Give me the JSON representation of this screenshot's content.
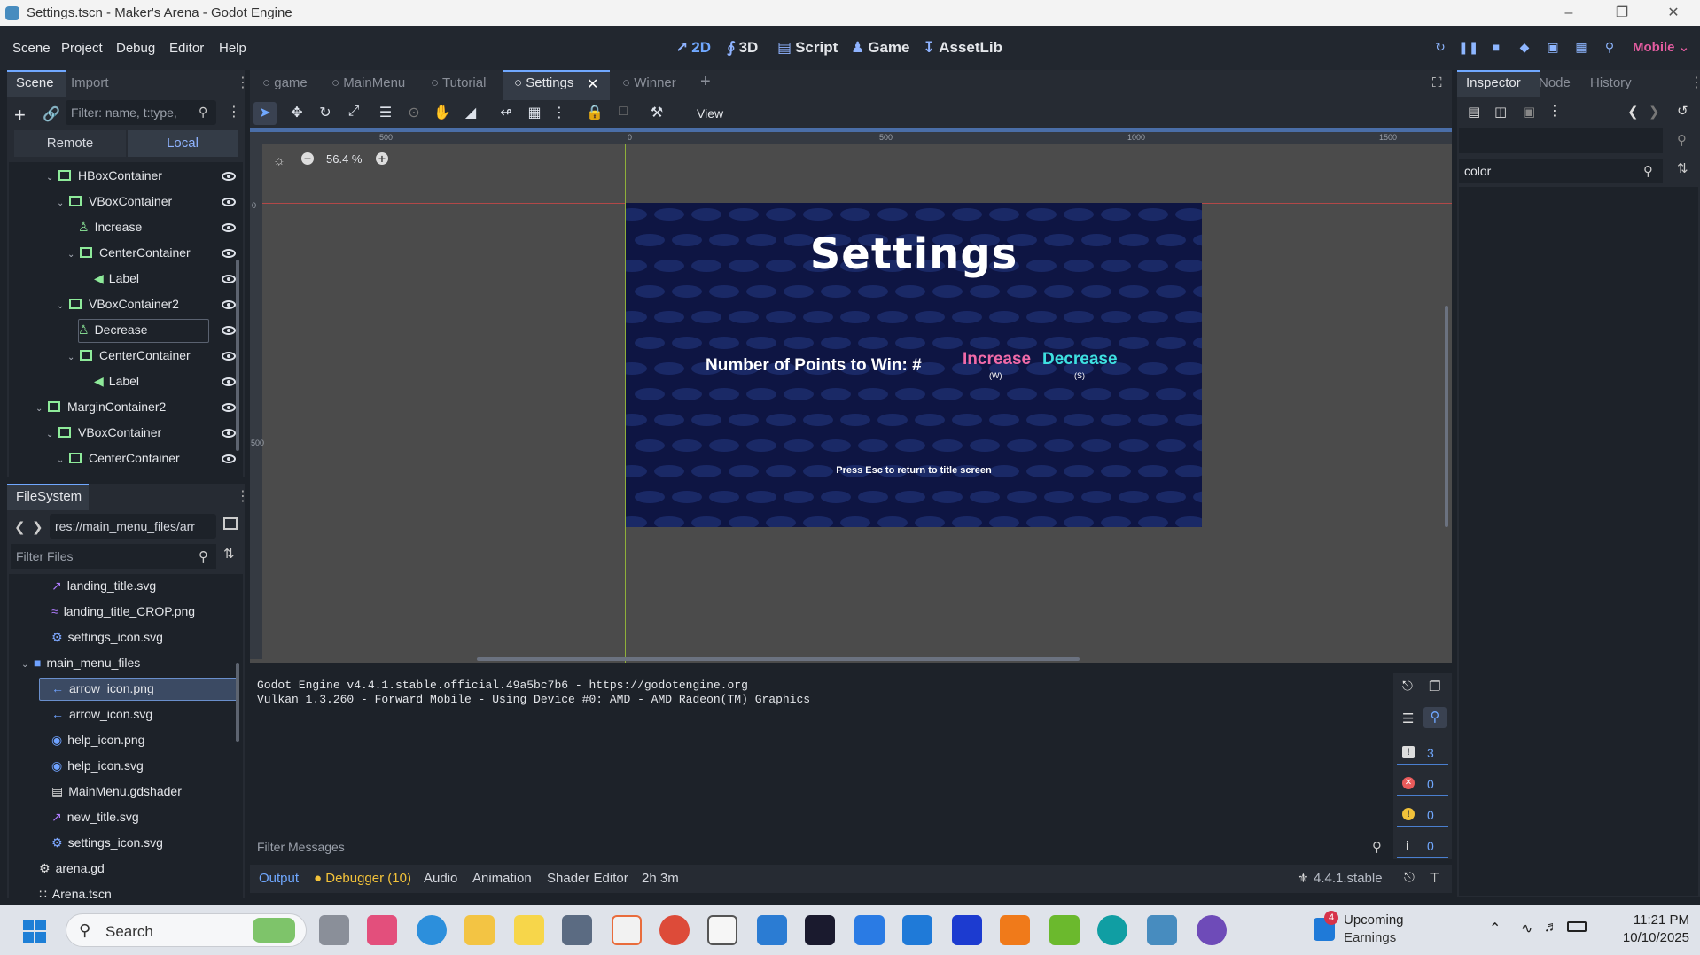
{
  "window": {
    "title": "Settings.tscn - Maker's Arena - Godot Engine"
  },
  "menu": [
    "Scene",
    "Project",
    "Debug",
    "Editor",
    "Help"
  ],
  "main_buttons": [
    "2D",
    "3D",
    "Script",
    "Game",
    "AssetLib"
  ],
  "renderer": "Mobile",
  "left_dock": {
    "tabs": [
      "Scene",
      "Import"
    ],
    "filter_placeholder": "Filter: name, t:type,",
    "remote_label": "Remote",
    "local_label": "Local",
    "tree": [
      "HBoxContainer",
      "VBoxContainer",
      "Increase",
      "CenterContainer",
      "Label",
      "VBoxContainer2",
      "Decrease",
      "CenterContainer",
      "Label",
      "MarginContainer2",
      "VBoxContainer",
      "CenterContainer"
    ]
  },
  "filesystem": {
    "title": "FileSystem",
    "path": "res://main_menu_files/arr",
    "filter_placeholder": "Filter Files",
    "files": [
      "landing_title.svg",
      "landing_title_CROP.png",
      "settings_icon.svg",
      "main_menu_files",
      "arrow_icon.png",
      "arrow_icon.svg",
      "help_icon.png",
      "help_icon.svg",
      "MainMenu.gdshader",
      "new_title.svg",
      "settings_icon.svg",
      "arena.gd",
      "Arena.tscn"
    ]
  },
  "scene_tabs": [
    "game",
    "MainMenu",
    "Tutorial",
    "Settings",
    "Winner"
  ],
  "toolbar": {
    "view_label": "View"
  },
  "viewport": {
    "zoom": "56.4 %",
    "ruler_labels": [
      "500",
      "0",
      "500",
      "1000",
      "1500"
    ],
    "ruler_v_labels": [
      "0",
      "500"
    ]
  },
  "game": {
    "title": "Settings",
    "points_label": "Number of Points to Win: #",
    "increase": "Increase",
    "increase_key": "(W)",
    "decrease": "Decrease",
    "decrease_key": "(S)",
    "esc_hint": "Press Esc to return to title screen",
    "colors": {
      "increase": "#f06aa8",
      "decrease": "#3ee0e0",
      "canvas": "#0e1543"
    }
  },
  "console": {
    "lines": [
      "Godot Engine v4.4.1.stable.official.49a5bc7b6 - https://godotengine.org",
      "Vulkan 1.3.260 - Forward Mobile - Using Device #0: AMD - AMD Radeon(TM) Graphics"
    ],
    "filter_placeholder": "Filter Messages",
    "counts": [
      "3",
      "0",
      "0",
      "0"
    ]
  },
  "bottom_tabs": [
    "Output",
    "Debugger (10)",
    "Audio",
    "Animation",
    "Shader Editor",
    "2h 3m"
  ],
  "version": "4.4.1.stable",
  "inspector": {
    "tabs": [
      "Inspector",
      "Node",
      "History"
    ],
    "search_value": "color"
  },
  "taskbar": {
    "search": "Search",
    "news_badge": "4",
    "news_line1": "Upcoming",
    "news_line2": "Earnings",
    "time": "11:21 PM",
    "date": "10/10/2025"
  }
}
